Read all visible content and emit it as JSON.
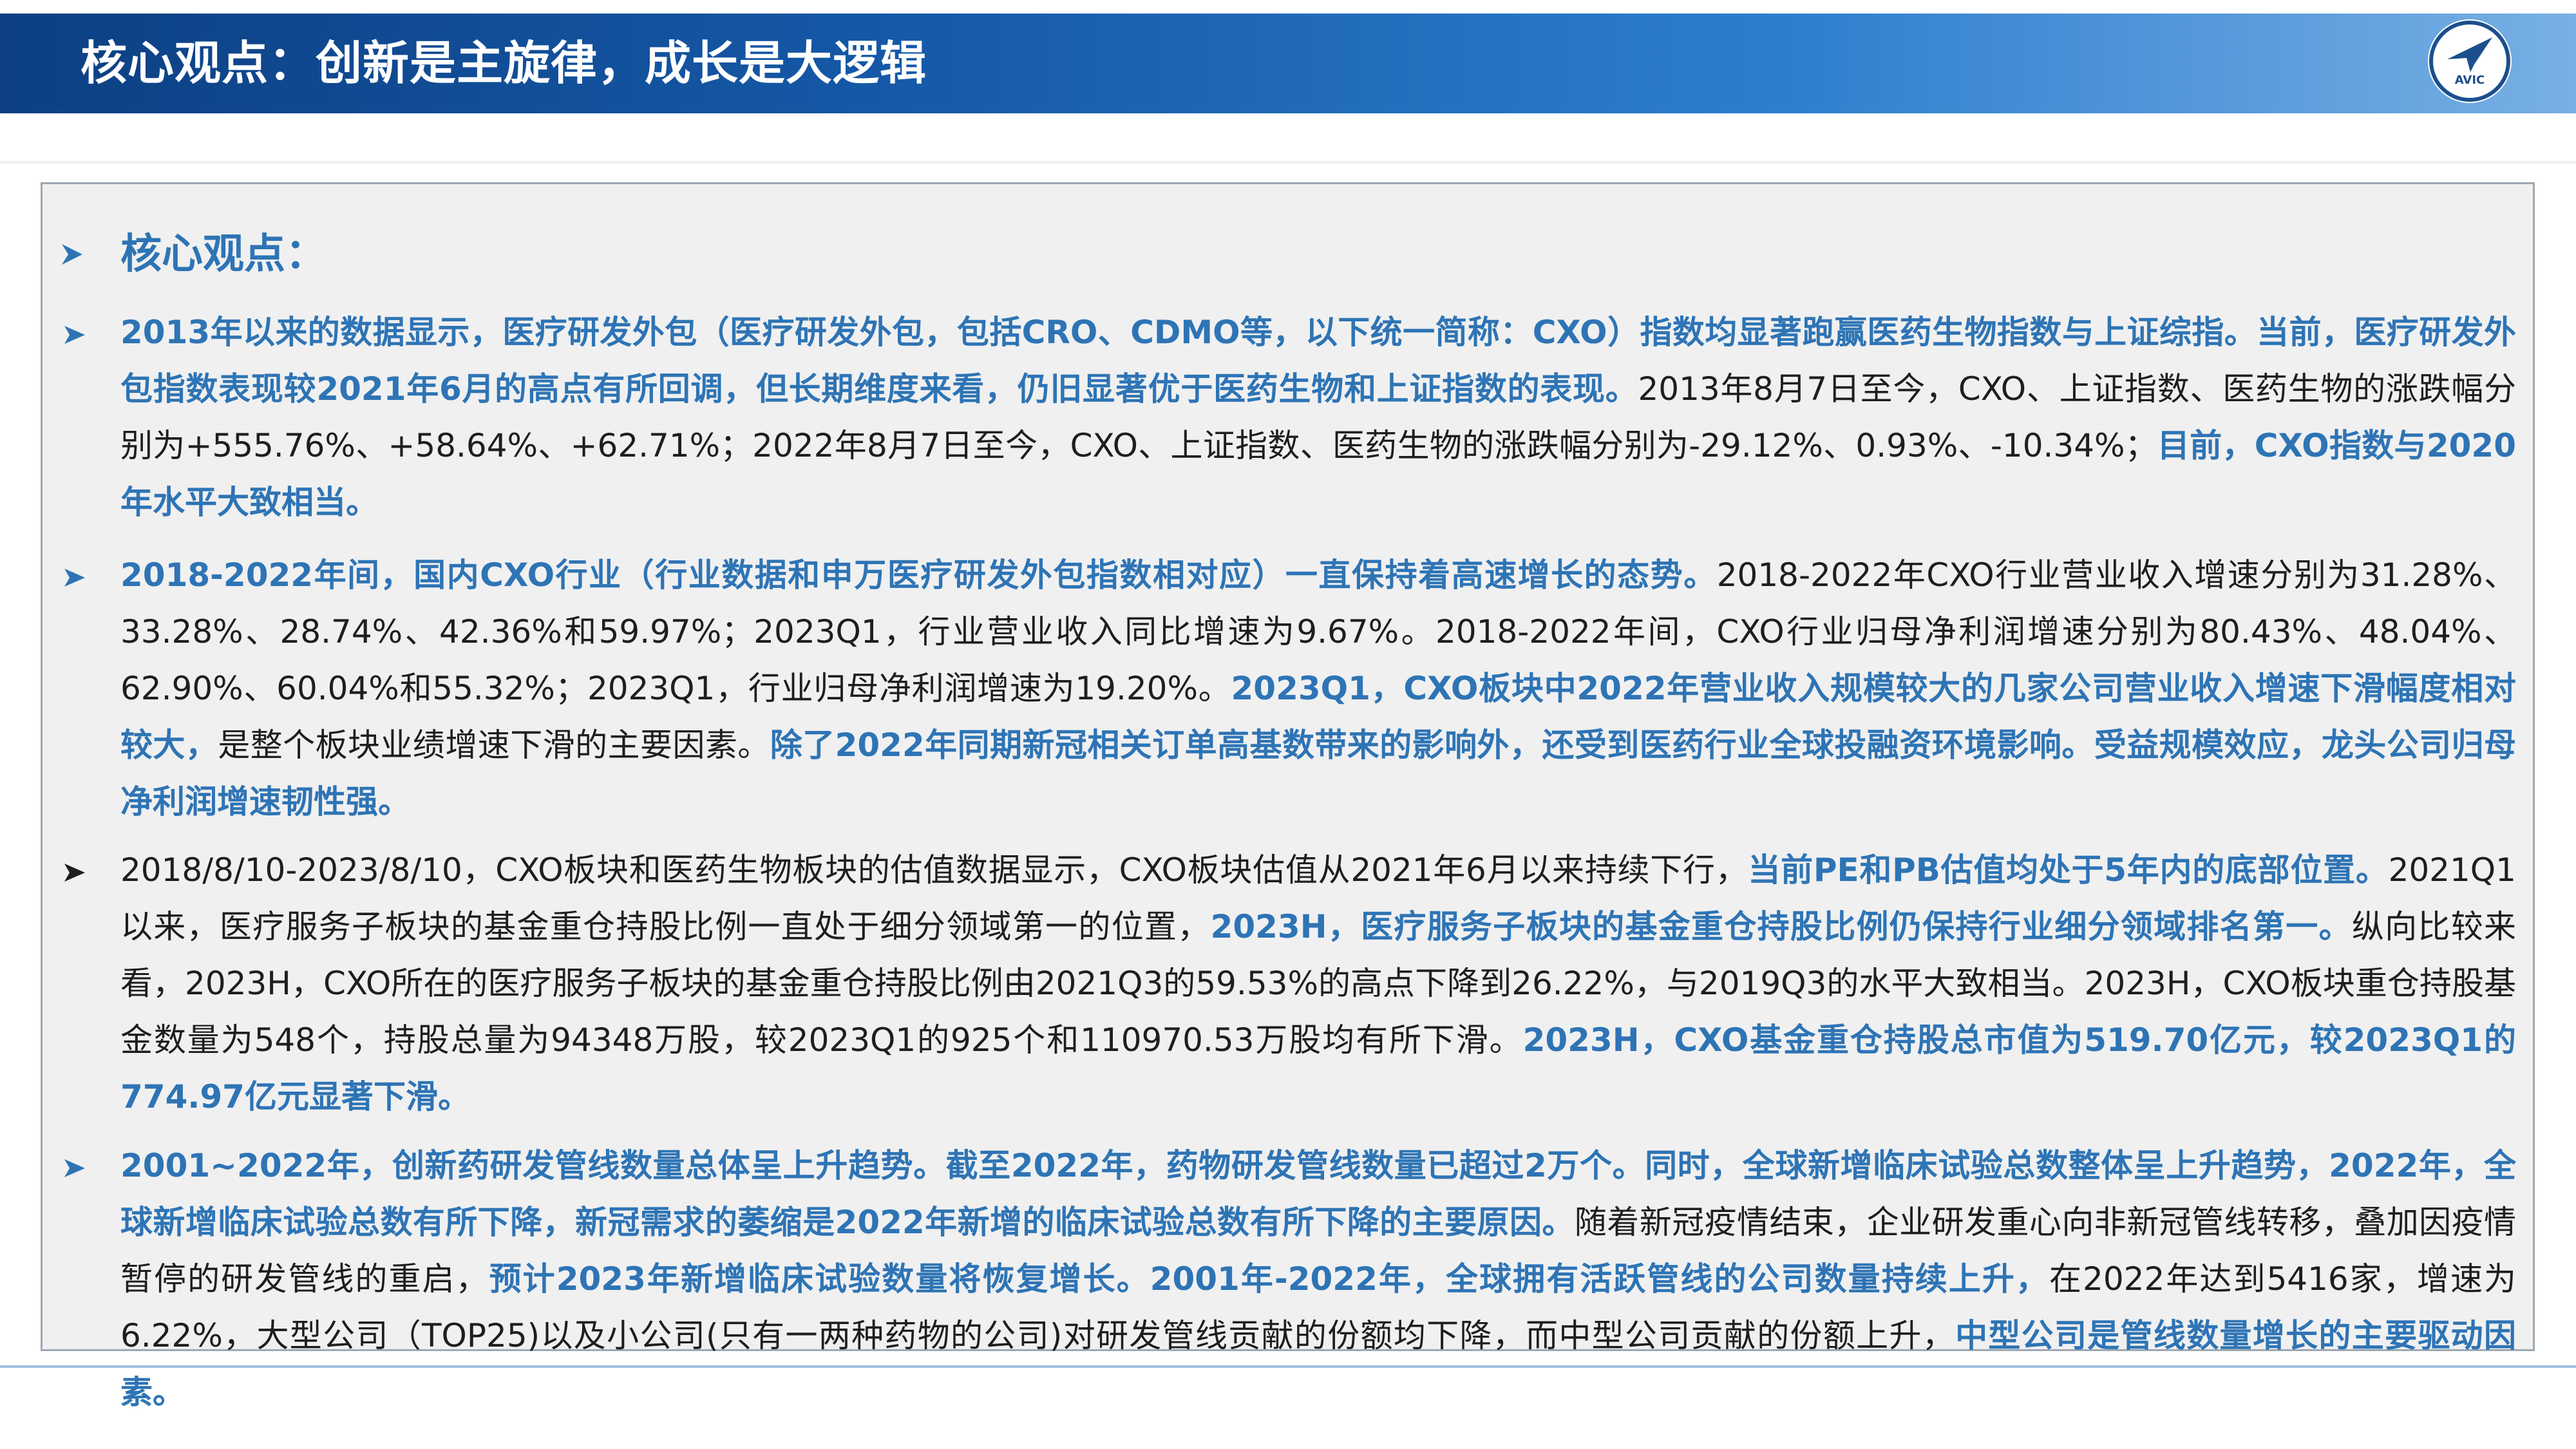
{
  "header": {
    "title": "核心观点：创新是主旋律，成长是大逻辑",
    "logo_text": "AVIC"
  },
  "colors": {
    "header_dark": "#0d3f82",
    "header_light": "#78b0e4",
    "accent_blue": "#2e74b5",
    "body_text": "#1e1e1e",
    "panel_bg": "#f0f0f0"
  },
  "content": {
    "heading": "核心观点：",
    "paragraphs": [
      {
        "bullet_color": "#2e74b5",
        "segments": [
          {
            "t": "2013年以来的数据显示，医疗研发外包（医疗研发外包，包括CRO、CDMO等，以下统一简称：CXO）指数均显著跑赢医药生物指数与上证综指。当前，医疗研发外包指数表现较2021年6月的高点有所回调，但长期维度来看，仍旧显著优于医药生物和上证指数的表现。",
            "bold": true
          },
          {
            "t": "2013年8月7日至今，CXO、上证指数、医药生物的涨跌幅分别为+555.76%、+58.64%、+62.71%；2022年8月7日至今，CXO、上证指数、医药生物的涨跌幅分别为-29.12%、0.93%、-10.34%；",
            "bold": false
          },
          {
            "t": "目前，CXO指数与2020年水平大致相当。",
            "bold": true
          }
        ]
      },
      {
        "bullet_color": "#2e74b5",
        "segments": [
          {
            "t": "2018-2022年间，国内CXO行业（行业数据和申万医疗研发外包指数相对应）一直保持着高速增长的态势。",
            "bold": true
          },
          {
            "t": "2018-2022年CXO行业营业收入增速分别为31.28%、33.28%、28.74%、42.36%和59.97%；2023Q1，行业营业收入同比增速为9.67%。2018-2022年间，CXO行业归母净利润增速分别为80.43%、48.04%、62.90%、60.04%和55.32%；2023Q1，行业归母净利润增速为19.20%。",
            "bold": false
          },
          {
            "t": "2023Q1，CXO板块中2022年营业收入规模较大的几家公司营业收入增速下滑幅度相对较大，",
            "bold": true
          },
          {
            "t": "是整个板块业绩增速下滑的主要因素。",
            "bold": false
          },
          {
            "t": "除了2022年同期新冠相关订单高基数带来的影响外，还受到医药行业全球投融资环境影响。受益规模效应，龙头公司归母净利润增速韧性强。",
            "bold": true
          }
        ]
      },
      {
        "bullet_color": "#1e1e1e",
        "segments": [
          {
            "t": "2018/8/10-2023/8/10，CXO板块和医药生物板块的估值数据显示，CXO板块估值从2021年6月以来持续下行，",
            "bold": false
          },
          {
            "t": "当前PE和PB估值均处于5年内的底部位置。",
            "bold": true
          },
          {
            "t": "2021Q1以来，医疗服务子板块的基金重仓持股比例一直处于细分领域第一的位置，",
            "bold": false
          },
          {
            "t": "2023H，医疗服务子板块的基金重仓持股比例仍保持行业细分领域排名第一。",
            "bold": true
          },
          {
            "t": "纵向比较来看，2023H，CXO所在的医疗服务子板块的基金重仓持股比例由2021Q3的59.53%的高点下降到26.22%，与2019Q3的水平大致相当。2023H，CXO板块重仓持股基金数量为548个，持股总量为94348万股，较2023Q1的925个和110970.53万股均有所下滑。",
            "bold": false
          },
          {
            "t": "2023H，CXO基金重仓持股总市值为519.70亿元，较2023Q1的774.97亿元显著下滑。",
            "bold": true
          }
        ]
      },
      {
        "bullet_color": "#2e74b5",
        "segments": [
          {
            "t": "2001~2022年，创新药研发管线数量总体呈上升趋势。截至2022年，药物研发管线数量已超过2万个。同时，全球新增临床试验总数整体呈上升趋势，2022年，全球新增临床试验总数有所下降，新冠需求的萎缩是2022年新增的临床试验总数有所下降的主要原因。",
            "bold": true
          },
          {
            "t": "随着新冠疫情结束，企业研发重心向非新冠管线转移，叠加因疫情暂停的研发管线的重启，",
            "bold": false
          },
          {
            "t": "预计2023年新增临床试验数量将恢复增长。2001年-2022年，全球拥有活跃管线的公司数量持续上升，",
            "bold": true
          },
          {
            "t": "在2022年达到5416家，增速为6.22%，大型公司（TOP25)以及小公司(只有一两种药物的公司)对研发管线贡献的份额均下降，而中型公司贡献的份额上升，",
            "bold": false
          },
          {
            "t": "中型公司是管线数量增长的主要驱动因素。",
            "bold": true
          }
        ]
      }
    ]
  }
}
